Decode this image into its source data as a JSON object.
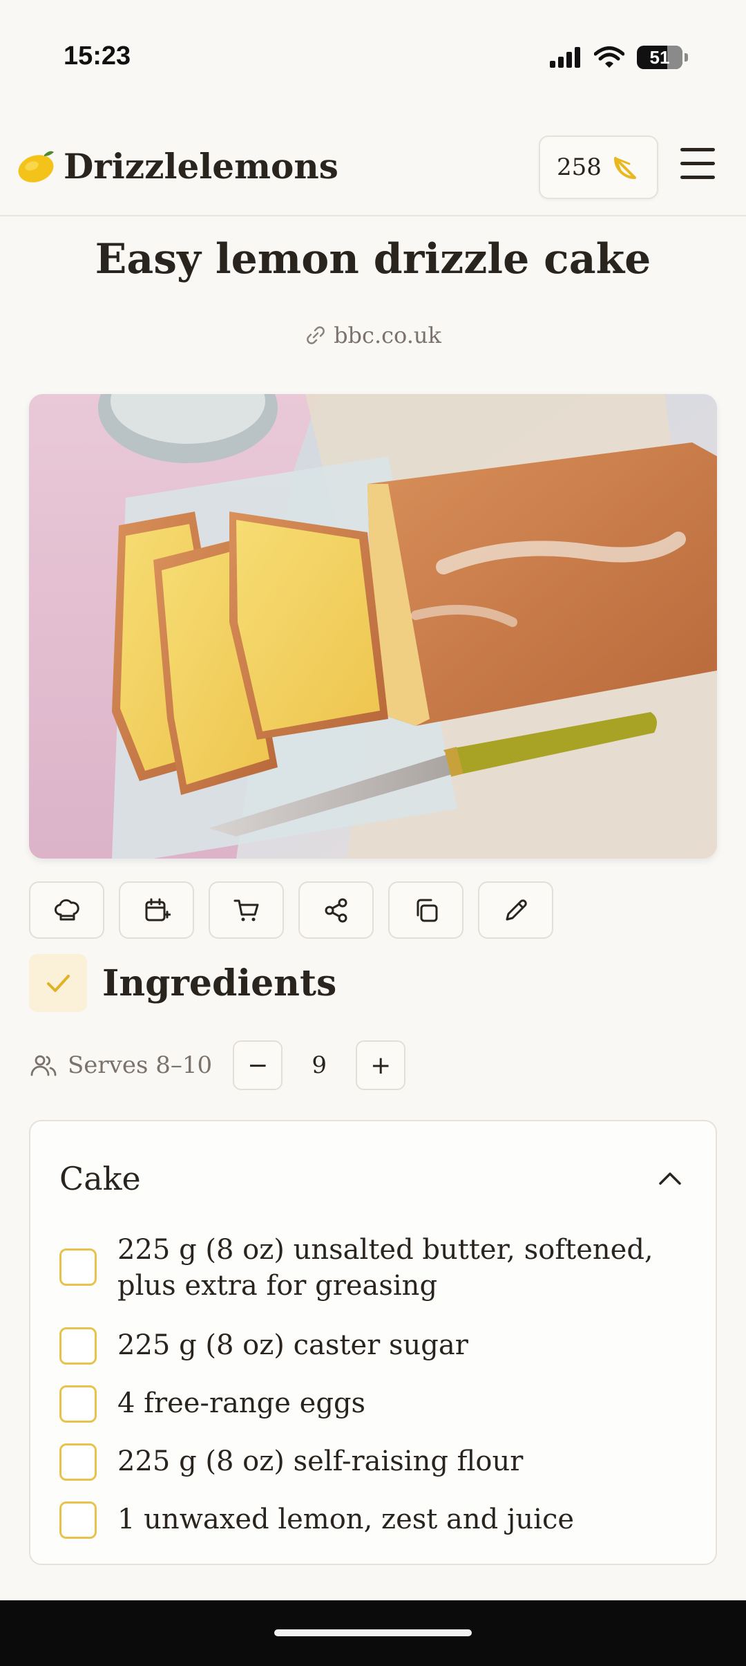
{
  "status_bar": {
    "time": "15:23",
    "battery": "51"
  },
  "header": {
    "brand": "Drizzlelemons",
    "counter": "258"
  },
  "recipe": {
    "title": "Easy lemon drizzle cake",
    "source": "bbc.co.uk"
  },
  "toolbar": {
    "buttons": [
      {
        "icon": "chef-hat-icon"
      },
      {
        "icon": "calendar-plus-icon"
      },
      {
        "icon": "cart-icon"
      },
      {
        "icon": "share-icon"
      },
      {
        "icon": "copy-icon"
      },
      {
        "icon": "pencil-icon"
      }
    ]
  },
  "ingredients": {
    "title": "Ingredients",
    "serves_label": "Serves 8–10",
    "minus": "−",
    "servings": "9",
    "plus": "+",
    "section": {
      "title": "Cake",
      "items": [
        "225 g (8 oz) unsalted butter, softened, plus extra for greasing",
        "225 g (8 oz) caster sugar",
        "4 free-range eggs",
        "225 g (8 oz) self-raising flour",
        "1 unwaxed lemon, zest and juice"
      ]
    }
  },
  "colors": {
    "accent": "#e8c24a",
    "text": "#2a241f",
    "muted": "#7a726b",
    "background": "#f9f8f5"
  }
}
